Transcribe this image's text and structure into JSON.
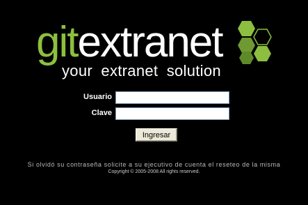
{
  "brand": {
    "name_part1": "git",
    "name_part2": "extranet",
    "tagline": "your extranet solution",
    "accent_color": "#8cbf3f",
    "logo_icon": "hexagon-cluster-icon"
  },
  "login_form": {
    "username_label": "Usuario",
    "username_value": "",
    "password_label": "Clave",
    "password_value": "",
    "submit_label": "Ingresar"
  },
  "footer": {
    "notice": "Si olvidó su contraseña solicite a su ejecutivo de cuenta el reseteo de la misma",
    "copyright": "Copyright © 2005-2008 All rights reserved."
  }
}
